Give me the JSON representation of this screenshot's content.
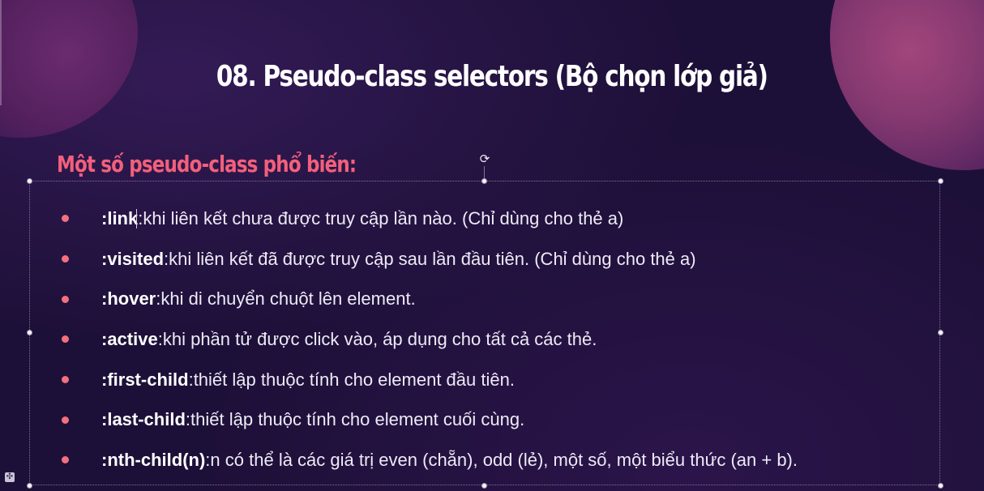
{
  "slide": {
    "title": "08. Pseudo-class selectors (Bộ chọn lớp giả)",
    "subtitle": "Một số pseudo-class phổ biến:",
    "items": [
      {
        "term": ":link",
        "separator": ": ",
        "description": "khi liên kết chưa được truy cập lần nào. (Chỉ dùng cho thẻ a)"
      },
      {
        "term": ":visited",
        "separator": ": ",
        "description": "khi liên kết đã được truy cập sau lần đầu tiên. (Chỉ dùng cho thẻ a)"
      },
      {
        "term": ":hover",
        "separator": ": ",
        "description": "khi di chuyển chuột lên element."
      },
      {
        "term": ":active",
        "separator": ": ",
        "description": "khi phần tử được click vào, áp dụng cho tất cả các thẻ."
      },
      {
        "term": ":first-child",
        "separator": ": ",
        "description": "thiết lập thuộc tính cho element đầu tiên."
      },
      {
        "term": ":last-child",
        "separator": ": ",
        "description": "thiết lập thuộc tính cho element cuối cùng."
      },
      {
        "term": ":nth-child(n)",
        "separator": ": ",
        "description": "n có thể là các giá trị even (chẵn), odd (lẻ), một số, một biểu thức (an + b)."
      }
    ]
  },
  "colors": {
    "background": "#1d1038",
    "subtitle": "#f2607b",
    "bullet": "#f4707f",
    "text": "#eeeaf6"
  },
  "icons": {
    "rotate": "rotate-icon",
    "corner": "slide-options-icon"
  }
}
